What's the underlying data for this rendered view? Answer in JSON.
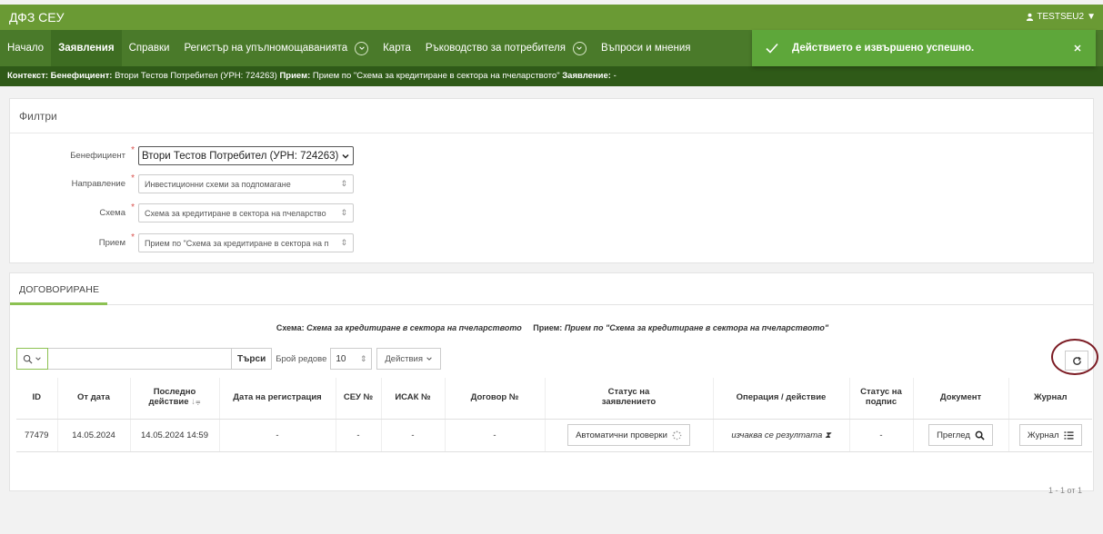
{
  "app": {
    "title": "ДФЗ СЕУ",
    "user": "TESTSEU2"
  },
  "nav": {
    "items": [
      {
        "label": "Начало",
        "active": false,
        "dropdown": false
      },
      {
        "label": "Заявления",
        "active": true,
        "dropdown": false
      },
      {
        "label": "Справки",
        "active": false,
        "dropdown": false
      },
      {
        "label": "Регистър на упълномощаванията",
        "active": false,
        "dropdown": true
      },
      {
        "label": "Карта",
        "active": false,
        "dropdown": false
      },
      {
        "label": "Ръководство за потребителя",
        "active": false,
        "dropdown": true
      },
      {
        "label": "Въпроси и мнения",
        "active": false,
        "dropdown": false
      }
    ]
  },
  "context": {
    "prefix": "Контекст:",
    "beneficiary_label": "Бенефициент:",
    "beneficiary_value": "Втори Тестов Потребител (УРН: 724263)",
    "intake_label": "Прием:",
    "intake_value": "Прием по \"Схема за кредитиране в сектора на пчеларството\"",
    "application_label": "Заявление:",
    "application_value": "-"
  },
  "toast": {
    "message": "Действието е извършено успешно."
  },
  "filters": {
    "title": "Филтри",
    "beneficiary": {
      "label": "Бенефициент",
      "value": "Втори Тестов Потребител (УРН: 724263)"
    },
    "direction": {
      "label": "Направление",
      "value": "Инвестиционни схеми за подпомагане"
    },
    "scheme": {
      "label": "Схема",
      "value": "Схема за кредитиране в сектора на пчеларство"
    },
    "intake": {
      "label": "Прием",
      "value": "Прием по \"Схема за кредитиране в сектора на п"
    }
  },
  "tab": {
    "label": "ДОГОВОРИРАНЕ"
  },
  "results": {
    "scheme_label": "Схема:",
    "scheme_value": "Схема за кредитиране в сектора на пчеларството",
    "intake_label": "Прием:",
    "intake_value": "Прием по \"Схема за кредитиране в сектора на пчеларството\"",
    "search_placeholder": "",
    "search_button": "Търси",
    "rows_label": "Брой редове",
    "rows_value": "10",
    "actions_label": "Действия",
    "pager": "1 - 1 от 1"
  },
  "table": {
    "headers": {
      "id": "ID",
      "from_date": "От дата",
      "last_action_line1": "Последно",
      "last_action_line2": "действие",
      "reg_date": "Дата на регистрация",
      "seu_no": "СЕУ №",
      "isak_no": "ИСАК №",
      "contract_no": "Договор №",
      "status_line1": "Статус на",
      "status_line2": "заявлението",
      "operation": "Операция / действие",
      "sign_status_line1": "Статус на",
      "sign_status_line2": "подпис",
      "document": "Документ",
      "journal": "Журнал"
    },
    "rows": [
      {
        "id": "77479",
        "from_date": "14.05.2024",
        "last_action": "14.05.2024 14:59",
        "reg_date": "-",
        "seu_no": "-",
        "isak_no": "-",
        "contract_no": "-",
        "status_button": "Автоматични проверки",
        "operation": "изчаква се резултата",
        "sign_status": "-",
        "document_button": "Преглед",
        "journal_button": "Журнал"
      }
    ]
  }
}
